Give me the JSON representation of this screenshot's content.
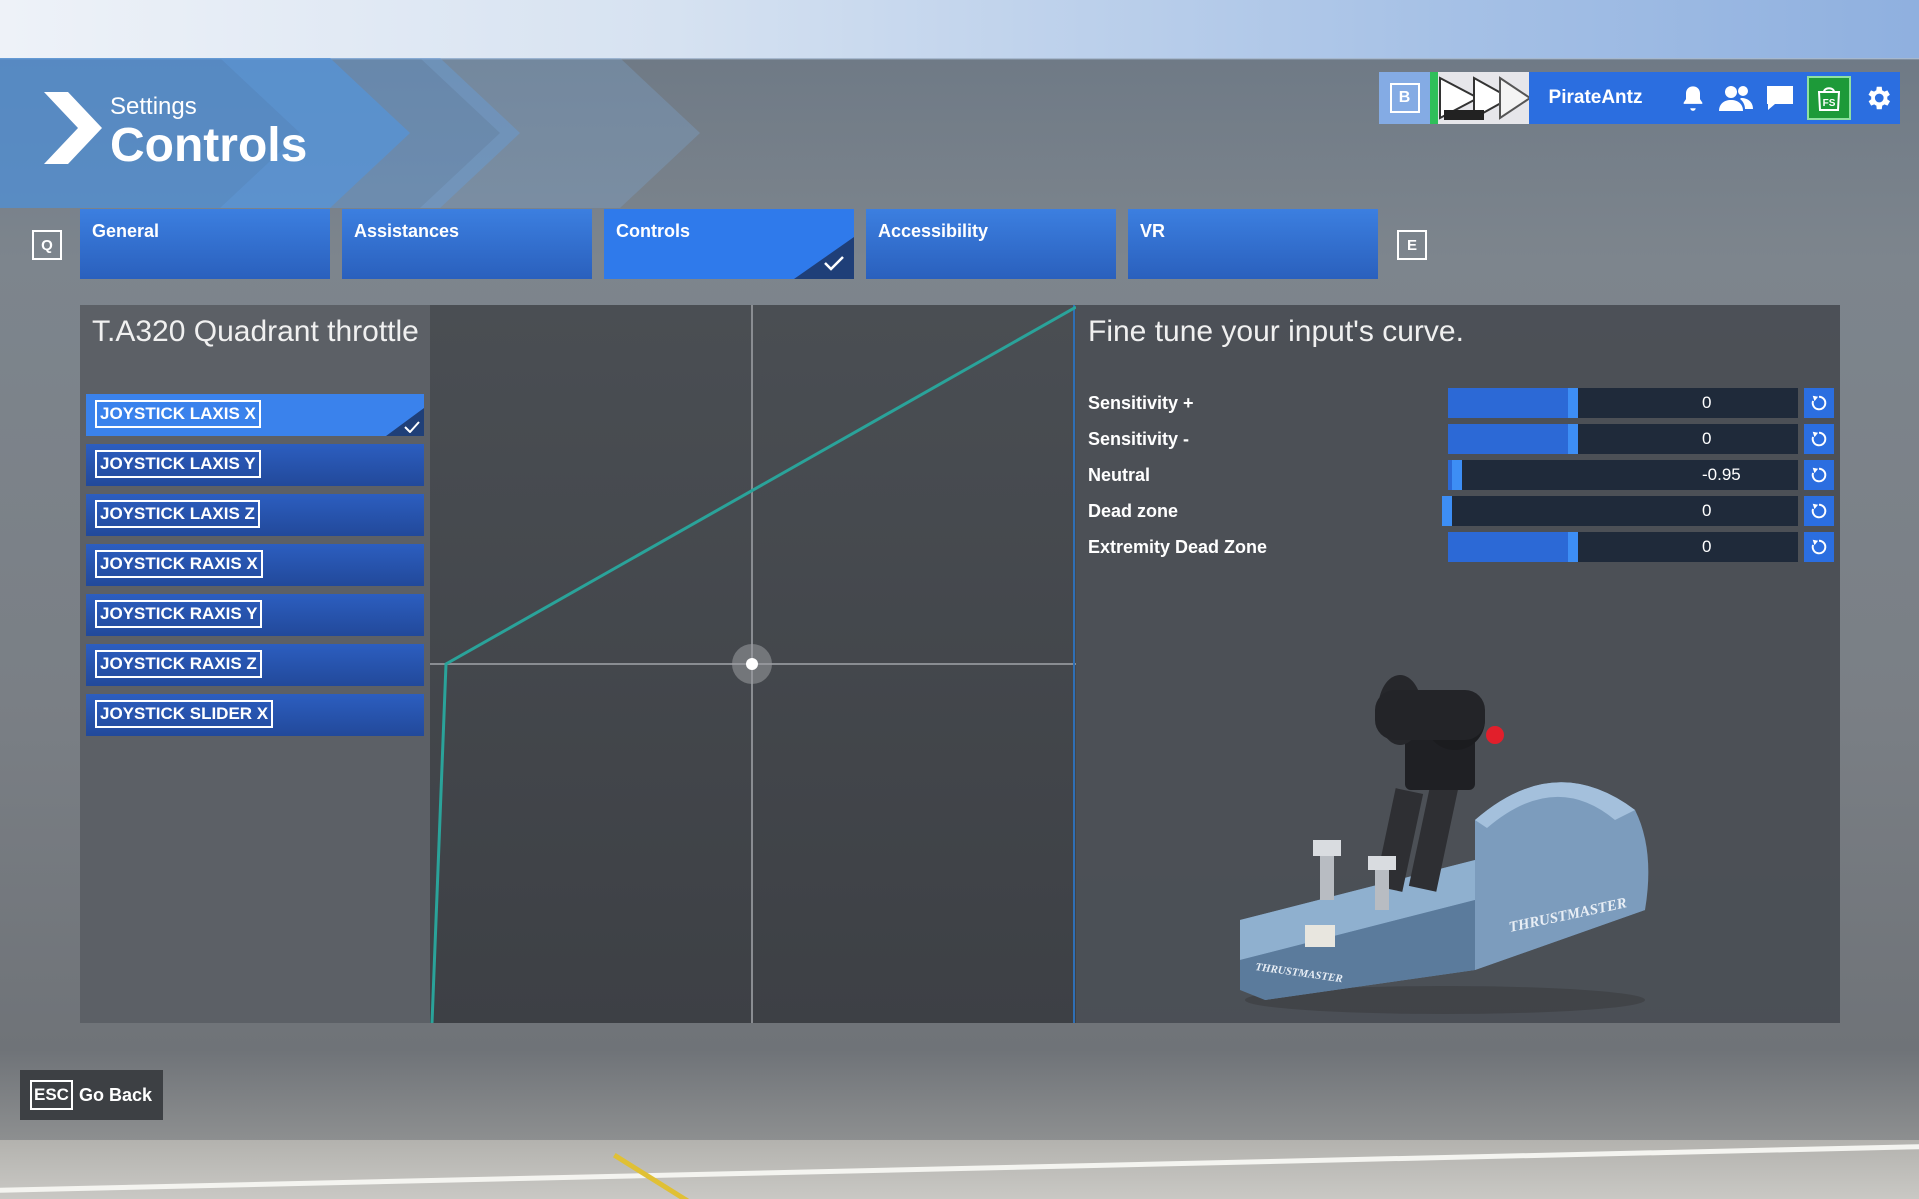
{
  "header": {
    "breadcrumb": "Settings",
    "title": "Controls"
  },
  "topbar": {
    "b_key": "B",
    "username": "PirateAntz",
    "icons": [
      "bell-icon",
      "friends-icon",
      "chat-icon",
      "store-icon",
      "gear-icon"
    ],
    "store_label": "FS"
  },
  "tabs": {
    "prev_key": "Q",
    "next_key": "E",
    "items": [
      {
        "label": "General"
      },
      {
        "label": "Assistances"
      },
      {
        "label": "Controls"
      },
      {
        "label": "Accessibility"
      },
      {
        "label": "VR"
      }
    ],
    "active": "Controls"
  },
  "device": {
    "title": "T.A320 Quadrant throttle",
    "axes": [
      {
        "label": "JOYSTICK LAXIS X"
      },
      {
        "label": "JOYSTICK LAXIS Y"
      },
      {
        "label": "JOYSTICK LAXIS Z"
      },
      {
        "label": "JOYSTICK RAXIS X"
      },
      {
        "label": "JOYSTICK RAXIS Y"
      },
      {
        "label": "JOYSTICK RAXIS Z"
      },
      {
        "label": "JOYSTICK SLIDER X"
      }
    ],
    "selected_axis": "JOYSTICK LAXIS X"
  },
  "tuning": {
    "title": "Fine tune your input's curve.",
    "options": [
      {
        "label": "Sensitivity +",
        "value": "0",
        "level": 0.5
      },
      {
        "label": "Sensitivity -",
        "value": "0",
        "level": 0.5
      },
      {
        "label": "Neutral",
        "value": "-0.95",
        "level": 0.025
      },
      {
        "label": "Dead zone",
        "value": "0",
        "level": 0.0
      },
      {
        "label": "Extremity Dead Zone",
        "value": "0",
        "level": 0.5
      }
    ]
  },
  "footer": {
    "esc_key": "ESC",
    "back_label": "Go Back"
  },
  "colors": {
    "accent": "#2b6ee0",
    "active_tab": "#2f7aeb",
    "panel": "#4a4e54",
    "curve": "#2aa39a"
  }
}
